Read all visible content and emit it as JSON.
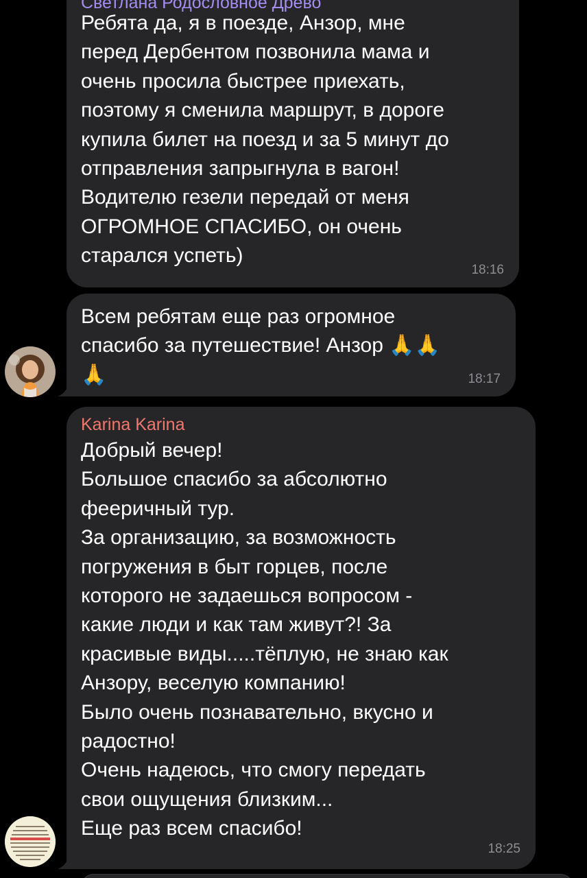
{
  "colors": {
    "background": "#000000",
    "bubble": "#262628",
    "sender_1": "#a48cf0",
    "sender_2": "#f2786c",
    "timestamp": "#8d8d93"
  },
  "messages": [
    {
      "sender": "Светлана Родословное Древо",
      "text": "Ребята да, я в поезде, Анзор, мне\nперед Дербентом позвонила мама и\nочень просила быстрее приехать,\nпоэтому я сменила маршрут, в дороге\nкупила билет на поезд и за 5 минут до\nотправления запрыгнула в вагон!\nВодителю гезели передай от меня\nОГРОМНОЕ СПАСИБО,  он очень\nстарался успеть)",
      "time": "18:16"
    },
    {
      "text": "Всем ребятам еще раз огромное\nспасибо за путешествие! Анзор 🙏🙏\n🙏",
      "time": "18:17",
      "avatar_icon": "woman-portrait-avatar"
    },
    {
      "sender": "Karina Karina",
      "text": "Добрый вечер!\nБольшое спасибо за абсолютно\nфееричный тур.\nЗа организацию, за возможность\nпогружения в быт горцев, после\nкоторого не задаешься  вопросом -\nкакие люди и как там живут?! За\nкрасивые виды.....тёплую, не знаю как\nАнзору, веселую компанию!\nБыло очень познавательно, вкусно и\nрадостно!\nОчень надеюсь, что смогу передать\nсвои ощущения близким...\nЕще раз всем спасибо!",
      "time": "18:25",
      "avatar_icon": "text-note-avatar"
    }
  ]
}
